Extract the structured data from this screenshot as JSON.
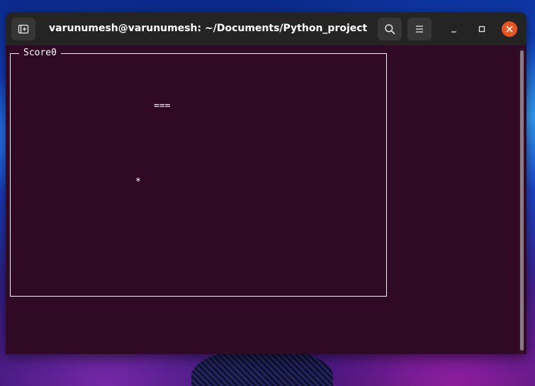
{
  "window": {
    "title": "varunumesh@varunumesh: ~/Documents/Python_projects/S..."
  },
  "icons": {
    "new_tab": "new-tab-icon",
    "search": "search-icon",
    "menu": "hamburger-menu-icon",
    "minimize": "minimize-icon",
    "maximize": "maximize-icon",
    "close": "close-icon"
  },
  "colors": {
    "terminal_bg": "#300a24",
    "titlebar_bg": "#242424",
    "close_accent": "#e95420",
    "foreground": "#ffffff"
  },
  "terminal": {
    "score_label": "Score0",
    "paddle": "===",
    "ball": "*"
  }
}
